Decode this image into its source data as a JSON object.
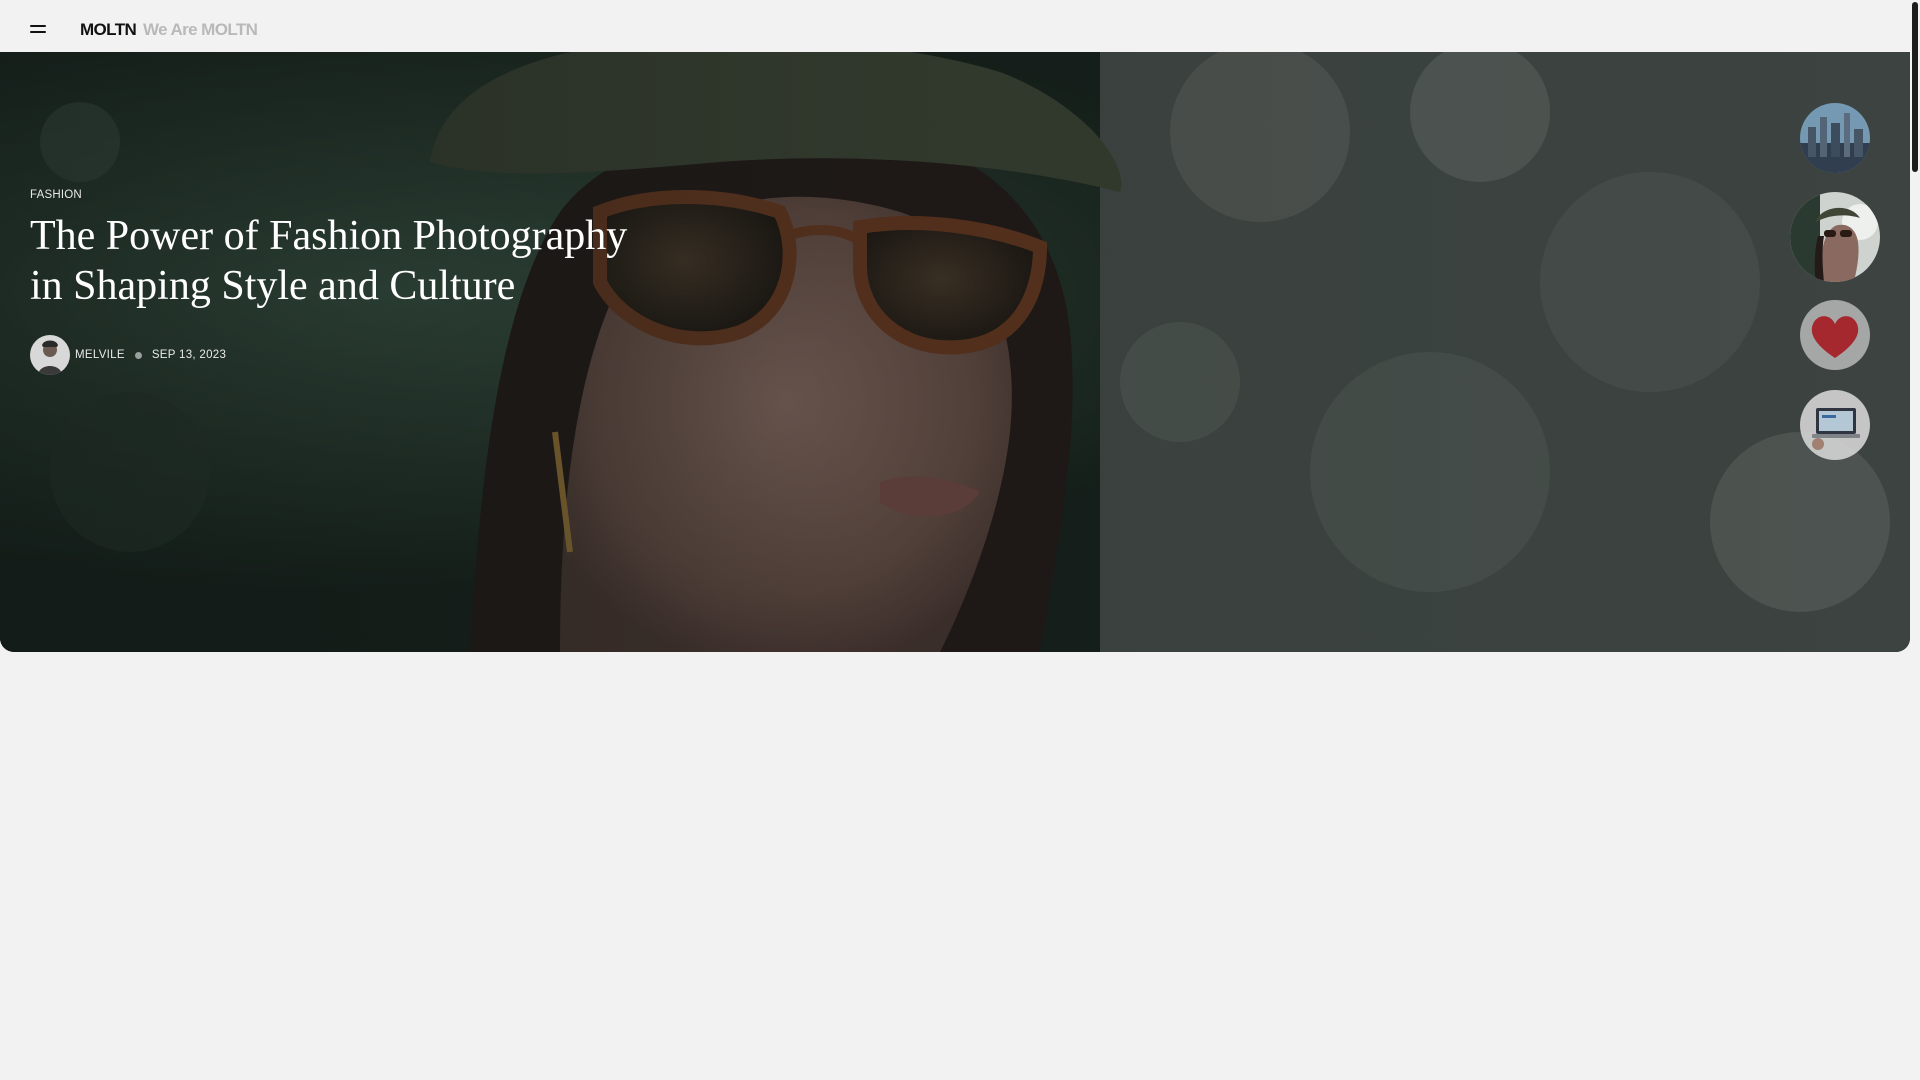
{
  "header": {
    "menu_icon": "hamburger-menu-icon",
    "brand": "MOLTN",
    "tagline": "We Are MOLTN"
  },
  "hero": {
    "category": "FASHION",
    "title": "The Power of Fashion Photography in Shaping Style and Culture",
    "author": "MELVILE",
    "date": "SEP 13, 2023"
  },
  "slider": {
    "thumbnails": [
      {
        "subject": "city-skyline",
        "active": false
      },
      {
        "subject": "woman-in-sunglasses",
        "active": true
      },
      {
        "subject": "red-heart",
        "active": false
      },
      {
        "subject": "laptop-screen",
        "active": false
      }
    ]
  },
  "colors": {
    "page_background": "#f2f2f2",
    "title_text": "#ffffff",
    "brand_text": "#111111",
    "tagline_text": "#b9b9b9"
  }
}
